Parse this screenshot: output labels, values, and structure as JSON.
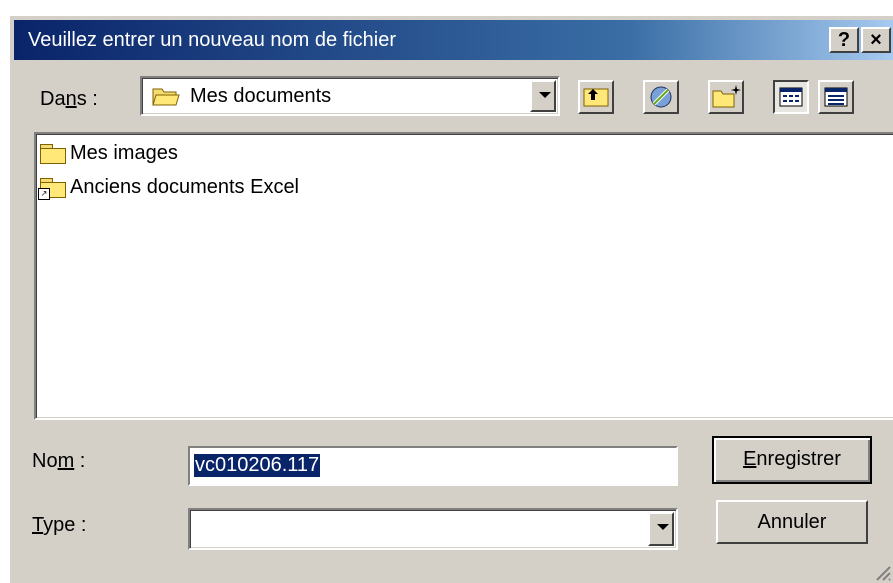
{
  "dialog": {
    "title": "Veuillez entrer un nouveau nom de fichier",
    "help_label": "?",
    "close_label": "×"
  },
  "location": {
    "label_pre": "Da",
    "label_u": "n",
    "label_post": "s :",
    "value": "Mes documents"
  },
  "toolbar": [
    {
      "name": "up-one-level-icon"
    },
    {
      "name": "search-web-icon"
    },
    {
      "name": "new-folder-icon"
    },
    {
      "name": "list-view-icon"
    },
    {
      "name": "details-view-icon"
    }
  ],
  "files": [
    {
      "label": "Mes images",
      "shortcut": false
    },
    {
      "label": "Anciens documents Excel",
      "shortcut": true
    }
  ],
  "filename": {
    "label_pre": "No",
    "label_u": "m",
    "label_post": " :",
    "value": "vc010206.117"
  },
  "filetype": {
    "label_u": "T",
    "label_post": "ype :",
    "value": ""
  },
  "buttons": {
    "save_u": "E",
    "save_rest": "nregistrer",
    "cancel": "Annuler"
  }
}
